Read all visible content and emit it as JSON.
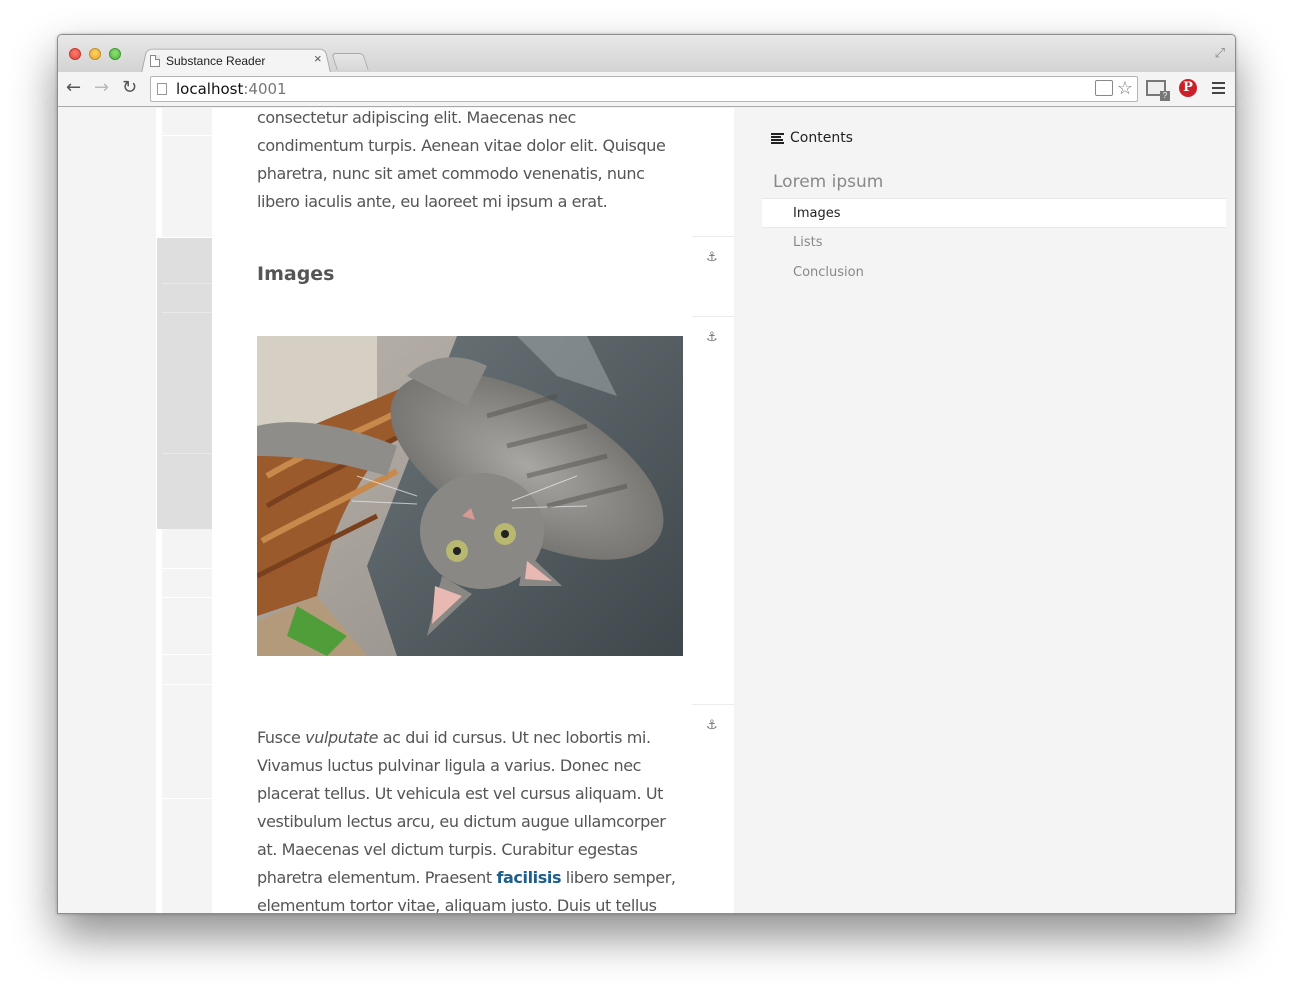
{
  "browser": {
    "tab_title": "Substance Reader",
    "tab_close": "×",
    "url_host": "localhost",
    "url_port": ":4001",
    "nav_back": "←",
    "nav_forward": "→",
    "nav_reload": "↻",
    "star": "☆",
    "expand": "⤢",
    "pinterest": "P",
    "gmail_badge": "?"
  },
  "document": {
    "intro_paragraph": "consectetur adipiscing elit. Maecenas nec condimentum turpis. Aenean vitae dolor elit. Quisque pharetra, nunc sit amet commodo venenatis, nunc libero iaculis ante, eu laoreet mi ipsum a erat.",
    "section_heading": "Images",
    "image_alt": "Gray tabby cat lying upside down on a leather couch next to a wicker basket",
    "anchor_glyph": "⚓",
    "paragraph2": {
      "part1": "Fusce ",
      "emphasis": "vulputate",
      "part2": " ac dui id cursus. Ut nec lobortis mi. Vivamus luctus pulvinar ligula a varius. Donec nec placerat tellus. Ut vehicula est vel cursus aliquam. Ut vestibulum lectus arcu, eu dictum augue ullamcorper at. Maecenas vel dictum turpis. Curabitur egestas pharetra elementum. Praesent ",
      "link": "facilisis",
      "part3": " libero semper, elementum tortor vitae, aliquam justo. Duis ut tellus"
    }
  },
  "toc": {
    "header": "Contents",
    "section": "Lorem ipsum",
    "items": [
      {
        "label": "Images",
        "active": true
      },
      {
        "label": "Lists",
        "active": false
      },
      {
        "label": "Conclusion",
        "active": false
      }
    ]
  }
}
